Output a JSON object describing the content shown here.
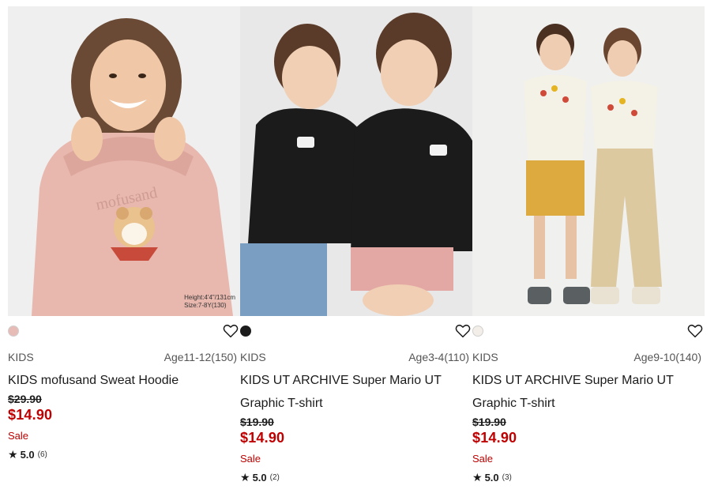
{
  "products": [
    {
      "swatch_color": "#e8bcb6",
      "gender": "KIDS",
      "size_range": "Age11-12(150)",
      "name": "KIDS mofusand Sweat Hoodie",
      "original_price": "$29.90",
      "price": "$14.90",
      "sale_label": "Sale",
      "rating_star": "★",
      "rating": "5.0",
      "review_count": "(6)",
      "photo_note_line1": "Height:4'4\"/131cm",
      "photo_note_line2": "Size:7-8Y(130)"
    },
    {
      "swatch_color": "#1c1c1c",
      "gender": "KIDS",
      "size_range": "Age3-4(110)",
      "name": "KIDS UT ARCHIVE Super Mario UT Graphic T-shirt",
      "original_price": "$19.90",
      "price": "$14.90",
      "sale_label": "Sale",
      "rating_star": "★",
      "rating": "5.0",
      "review_count": "(2)"
    },
    {
      "swatch_color": "#f3efe8",
      "gender": "KIDS",
      "size_range": "Age9-10(140)",
      "name": "KIDS UT ARCHIVE Super Mario UT Graphic T-shirt",
      "original_price": "$19.90",
      "price": "$14.90",
      "sale_label": "Sale",
      "rating_star": "★",
      "rating": "5.0",
      "review_count": "(3)"
    }
  ],
  "icons": {
    "favorite": "heart-icon",
    "rating": "star-icon"
  },
  "colors": {
    "sale_red": "#c00000",
    "text": "#1b1b1b"
  }
}
